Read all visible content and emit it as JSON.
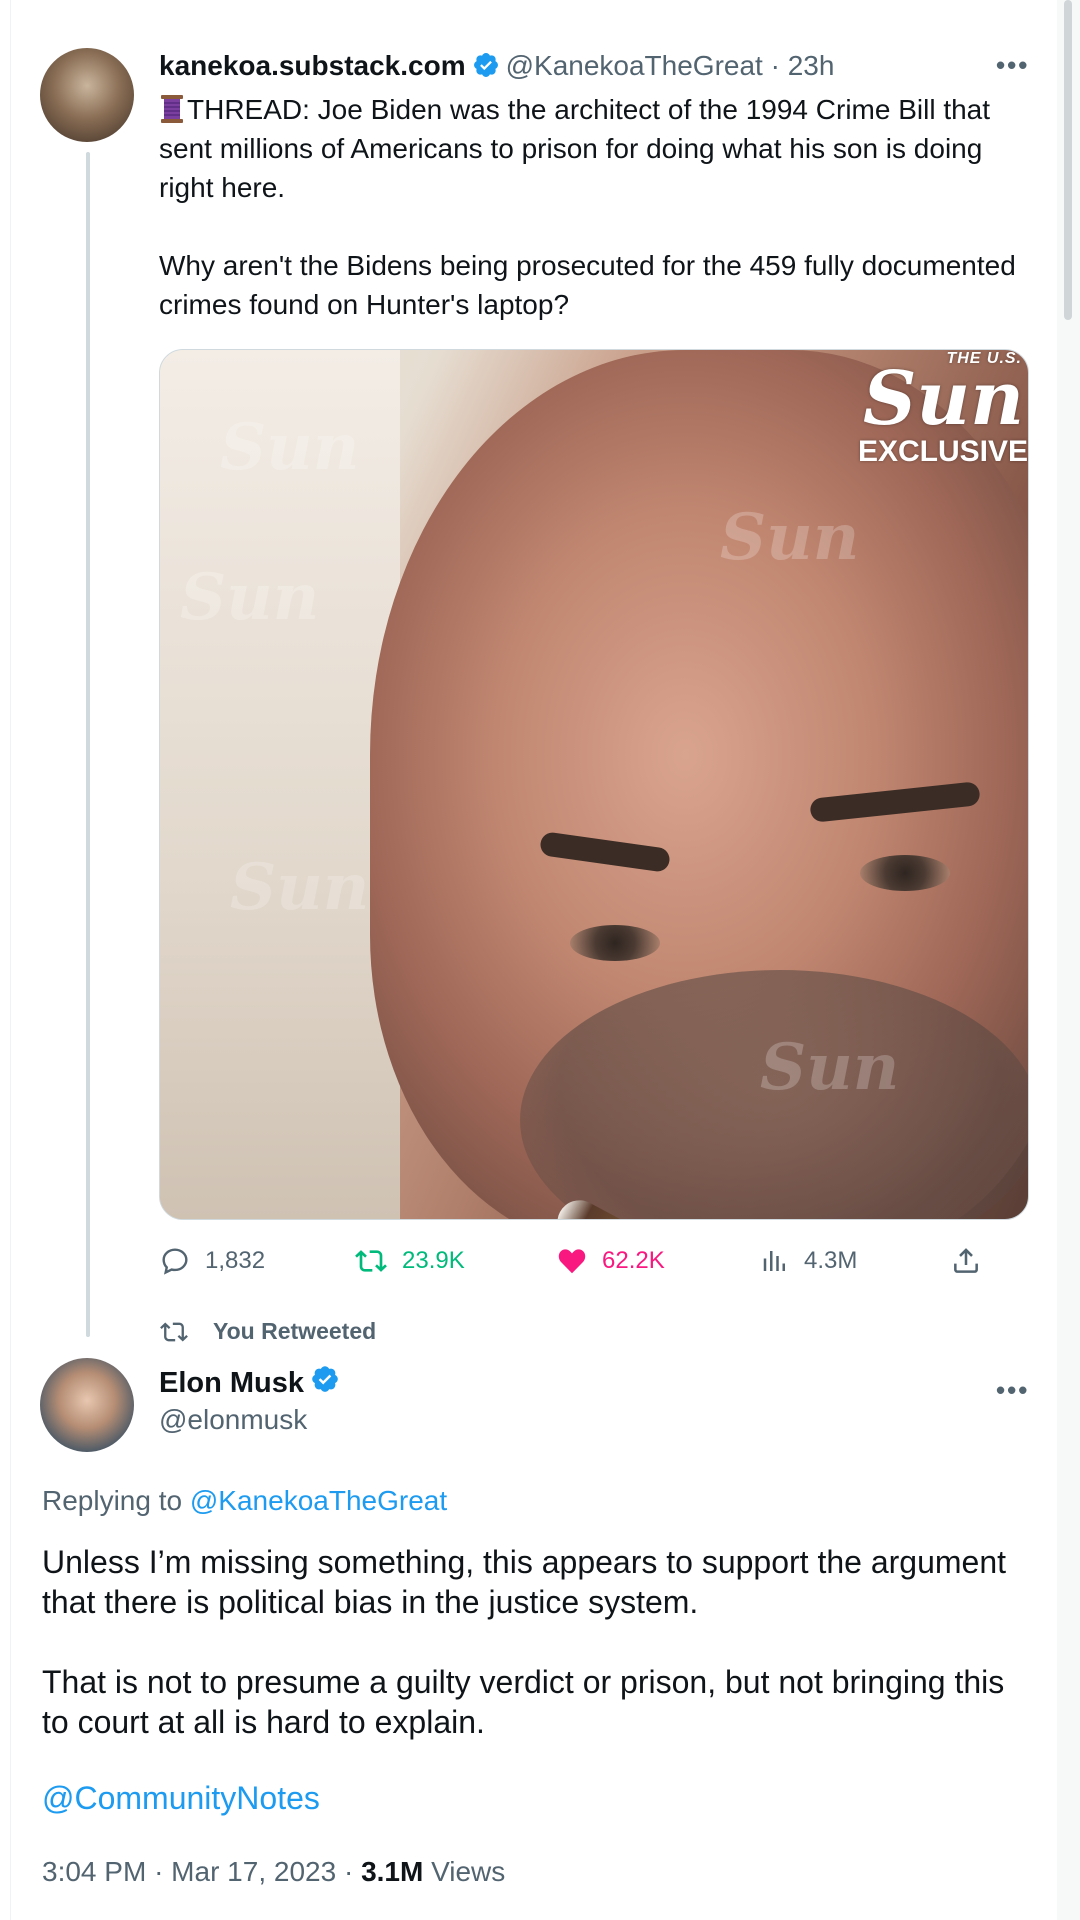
{
  "thread_tweet": {
    "display_name": "kanekoa.substack.com",
    "handle": "@KanekoaTheGreat",
    "time_ago": "23h",
    "text_line1": "THREAD: Joe Biden was the architect of the 1994 Crime Bill that sent millions of Americans to prison for doing what his son is doing right here.",
    "text_line2": "Why aren't the Bidens being prosecuted for the 459 fully documented crimes found on Hunter's laptop?",
    "media": {
      "brand_small": "THE U.S.",
      "brand_big": "Sun",
      "brand_tag": "EXCLUSIVE",
      "watermark": "Sun"
    },
    "stats": {
      "replies": "1,832",
      "retweets": "23.9K",
      "likes": "62.2K",
      "views": "4.3M"
    }
  },
  "retweet_banner": "You Retweeted",
  "main_tweet": {
    "display_name": "Elon Musk",
    "handle": "@elonmusk",
    "replying_label": "Replying to",
    "replying_to": "@KanekoaTheGreat",
    "paragraph1": "Unless I’m missing something, this appears to support the argument that there is political bias in the justice system.",
    "paragraph2": "That is not to presume a guilty verdict or prison, but not bringing this to court at all is hard to explain.",
    "mention": "@CommunityNotes",
    "time": "3:04 PM",
    "date": "Mar 17, 2023",
    "views_count": "3.1M",
    "views_label": "Views"
  },
  "colors": {
    "accent": "#1d9bf0",
    "retweet": "#00ba7c",
    "like": "#f91880",
    "muted": "#536471"
  },
  "icons": [
    "thread-spool-icon",
    "verified-badge-icon",
    "more-icon",
    "reply-icon",
    "retweet-icon",
    "heart-icon",
    "views-icon",
    "share-icon"
  ]
}
